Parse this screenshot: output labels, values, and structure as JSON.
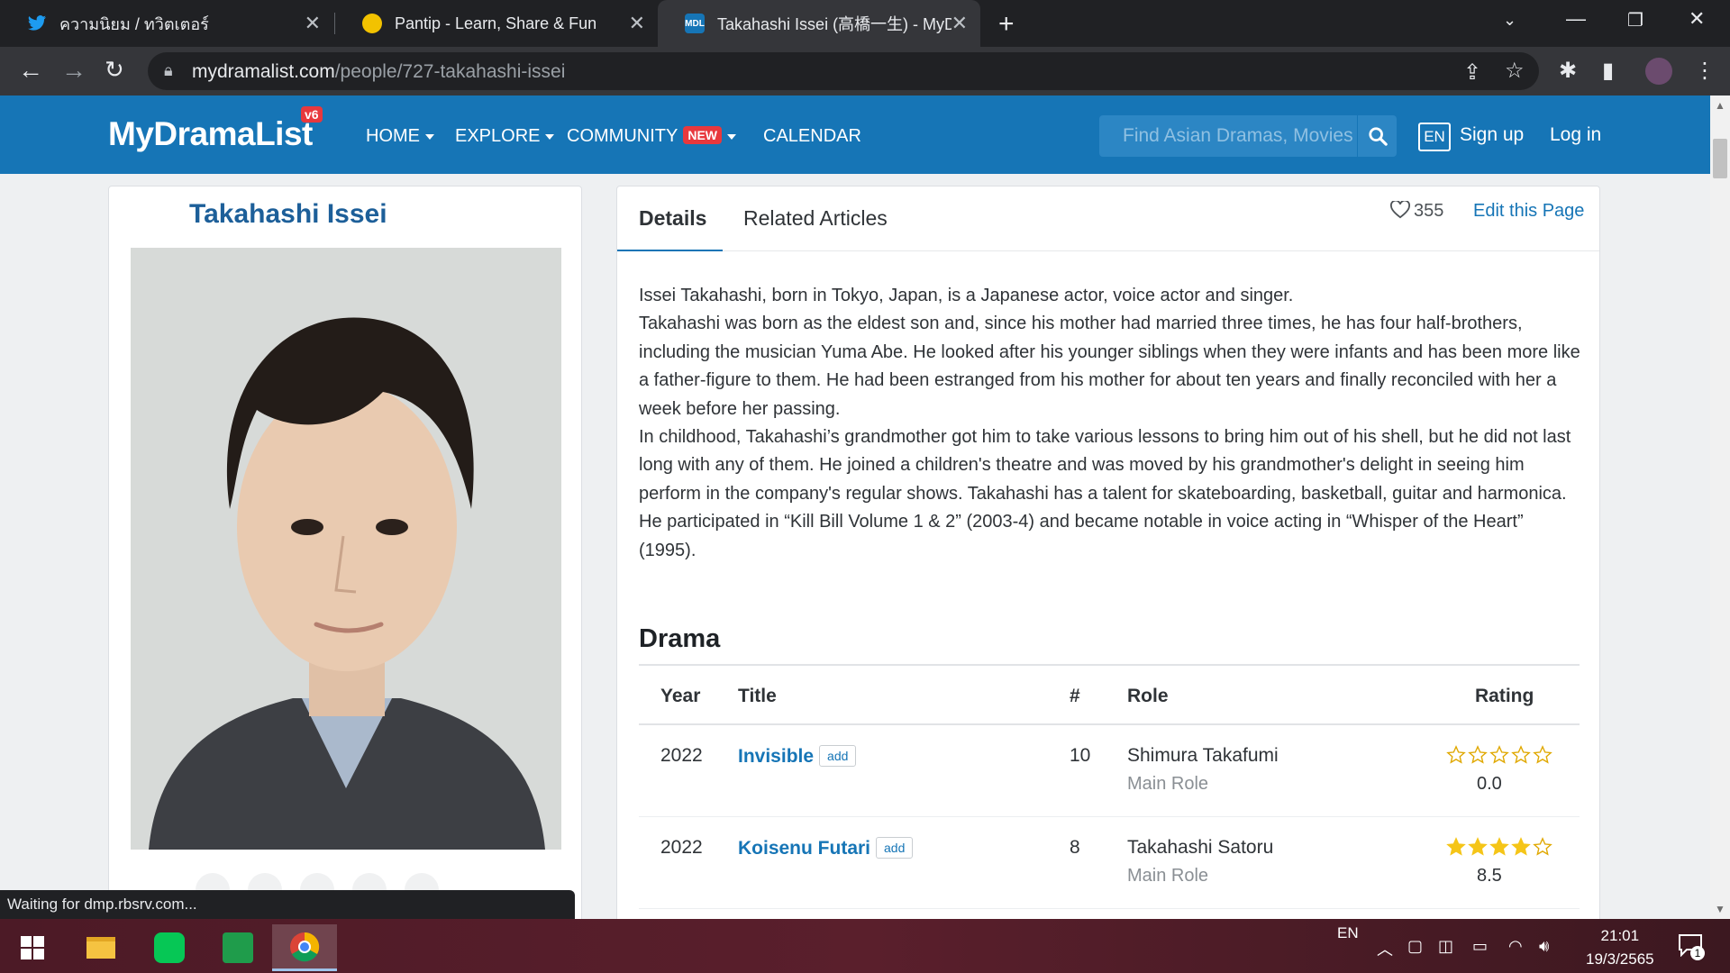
{
  "browser": {
    "tabs": [
      {
        "title": "ความนิยม / ทวิตเตอร์",
        "icon": "twitter-icon"
      },
      {
        "title": "Pantip - Learn, Share & Fun",
        "icon": "pantip-icon"
      },
      {
        "title": "Takahashi Issei (高橋一生) - MyDramaList",
        "icon": "mdl-icon",
        "favicon_text": "MDL",
        "active": true
      }
    ],
    "url_host": "mydramalist.com",
    "url_path": "/people/727-takahashi-issei"
  },
  "site": {
    "logo": "MyDramaList",
    "logo_badge": "v6",
    "menu": {
      "home": "HOME",
      "explore": "EXPLORE",
      "community": "COMMUNITY",
      "community_badge": "NEW",
      "calendar": "CALENDAR"
    },
    "search_placeholder": "Find Asian Dramas, Movies",
    "lang": "EN",
    "signup": "Sign up",
    "login": "Log in",
    "brand_color": "#1675b6"
  },
  "person": {
    "name": "Takahashi Issei"
  },
  "page_tabs": {
    "details": "Details",
    "articles": "Related Articles"
  },
  "likes": "355",
  "edit_page": "Edit this Page",
  "bio": [
    "Issei Takahashi, born in Tokyo, Japan, is a Japanese actor, voice actor and singer.",
    "Takahashi was born as the eldest son and, since his mother had married three times, he has four half-brothers, including the musician Yuma Abe. He looked after his younger siblings when they were infants and has been more like a father-figure to them. He had been estranged from his mother for about ten years and finally reconciled with her a week before her passing.",
    "In childhood, Takahashi’s grandmother got him to take various lessons to bring him out of his shell, but he did not last long with any of them. He joined a children's theatre and was moved by his grandmother's delight in seeing him perform in the company's regular shows. Takahashi has a talent for skateboarding, basketball, guitar and harmonica.",
    "He participated in “Kill Bill Volume 1 & 2” (2003-4) and became notable in voice acting in “Whisper of the Heart” (1995)."
  ],
  "drama": {
    "section_title": "Drama",
    "headers": {
      "year": "Year",
      "title": "Title",
      "episodes": "#",
      "role": "Role",
      "rating": "Rating"
    },
    "add_label": "add",
    "rows": [
      {
        "year": "2022",
        "title": "Invisible",
        "episodes": "10",
        "character": "Shimura Takafumi",
        "role_type": "Main Role",
        "rating": "0.0",
        "stars": 0
      },
      {
        "year": "2022",
        "title": "Koisenu Futari",
        "episodes": "8",
        "character": "Takahashi Satoru",
        "role_type": "Main Role",
        "rating": "8.5",
        "stars": 4
      }
    ]
  },
  "status_text": "Waiting for dmp.rbsrv.com...",
  "taskbar": {
    "lang": "EN",
    "time": "21:01",
    "date": "19/3/2565",
    "notifications": "1"
  }
}
